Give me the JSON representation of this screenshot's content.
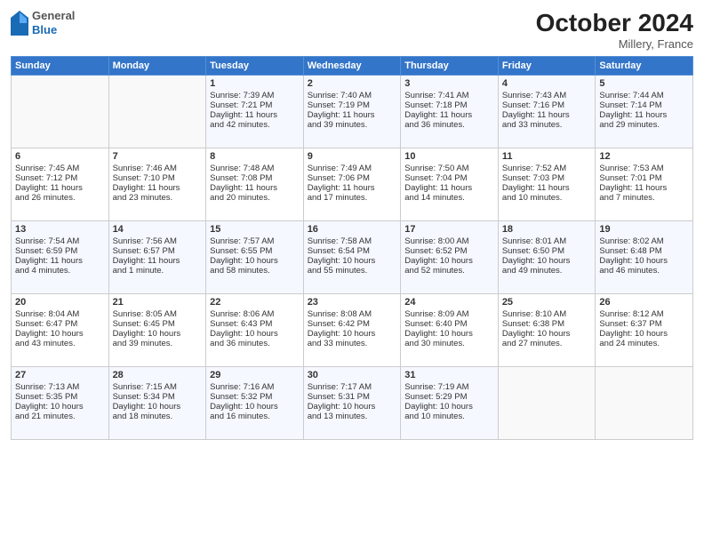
{
  "header": {
    "logo_general": "General",
    "logo_blue": "Blue",
    "month_title": "October 2024",
    "location": "Millery, France"
  },
  "weekdays": [
    "Sunday",
    "Monday",
    "Tuesday",
    "Wednesday",
    "Thursday",
    "Friday",
    "Saturday"
  ],
  "weeks": [
    [
      {
        "day": "",
        "lines": []
      },
      {
        "day": "",
        "lines": []
      },
      {
        "day": "1",
        "lines": [
          "Sunrise: 7:39 AM",
          "Sunset: 7:21 PM",
          "Daylight: 11 hours",
          "and 42 minutes."
        ]
      },
      {
        "day": "2",
        "lines": [
          "Sunrise: 7:40 AM",
          "Sunset: 7:19 PM",
          "Daylight: 11 hours",
          "and 39 minutes."
        ]
      },
      {
        "day": "3",
        "lines": [
          "Sunrise: 7:41 AM",
          "Sunset: 7:18 PM",
          "Daylight: 11 hours",
          "and 36 minutes."
        ]
      },
      {
        "day": "4",
        "lines": [
          "Sunrise: 7:43 AM",
          "Sunset: 7:16 PM",
          "Daylight: 11 hours",
          "and 33 minutes."
        ]
      },
      {
        "day": "5",
        "lines": [
          "Sunrise: 7:44 AM",
          "Sunset: 7:14 PM",
          "Daylight: 11 hours",
          "and 29 minutes."
        ]
      }
    ],
    [
      {
        "day": "6",
        "lines": [
          "Sunrise: 7:45 AM",
          "Sunset: 7:12 PM",
          "Daylight: 11 hours",
          "and 26 minutes."
        ]
      },
      {
        "day": "7",
        "lines": [
          "Sunrise: 7:46 AM",
          "Sunset: 7:10 PM",
          "Daylight: 11 hours",
          "and 23 minutes."
        ]
      },
      {
        "day": "8",
        "lines": [
          "Sunrise: 7:48 AM",
          "Sunset: 7:08 PM",
          "Daylight: 11 hours",
          "and 20 minutes."
        ]
      },
      {
        "day": "9",
        "lines": [
          "Sunrise: 7:49 AM",
          "Sunset: 7:06 PM",
          "Daylight: 11 hours",
          "and 17 minutes."
        ]
      },
      {
        "day": "10",
        "lines": [
          "Sunrise: 7:50 AM",
          "Sunset: 7:04 PM",
          "Daylight: 11 hours",
          "and 14 minutes."
        ]
      },
      {
        "day": "11",
        "lines": [
          "Sunrise: 7:52 AM",
          "Sunset: 7:03 PM",
          "Daylight: 11 hours",
          "and 10 minutes."
        ]
      },
      {
        "day": "12",
        "lines": [
          "Sunrise: 7:53 AM",
          "Sunset: 7:01 PM",
          "Daylight: 11 hours",
          "and 7 minutes."
        ]
      }
    ],
    [
      {
        "day": "13",
        "lines": [
          "Sunrise: 7:54 AM",
          "Sunset: 6:59 PM",
          "Daylight: 11 hours",
          "and 4 minutes."
        ]
      },
      {
        "day": "14",
        "lines": [
          "Sunrise: 7:56 AM",
          "Sunset: 6:57 PM",
          "Daylight: 11 hours",
          "and 1 minute."
        ]
      },
      {
        "day": "15",
        "lines": [
          "Sunrise: 7:57 AM",
          "Sunset: 6:55 PM",
          "Daylight: 10 hours",
          "and 58 minutes."
        ]
      },
      {
        "day": "16",
        "lines": [
          "Sunrise: 7:58 AM",
          "Sunset: 6:54 PM",
          "Daylight: 10 hours",
          "and 55 minutes."
        ]
      },
      {
        "day": "17",
        "lines": [
          "Sunrise: 8:00 AM",
          "Sunset: 6:52 PM",
          "Daylight: 10 hours",
          "and 52 minutes."
        ]
      },
      {
        "day": "18",
        "lines": [
          "Sunrise: 8:01 AM",
          "Sunset: 6:50 PM",
          "Daylight: 10 hours",
          "and 49 minutes."
        ]
      },
      {
        "day": "19",
        "lines": [
          "Sunrise: 8:02 AM",
          "Sunset: 6:48 PM",
          "Daylight: 10 hours",
          "and 46 minutes."
        ]
      }
    ],
    [
      {
        "day": "20",
        "lines": [
          "Sunrise: 8:04 AM",
          "Sunset: 6:47 PM",
          "Daylight: 10 hours",
          "and 43 minutes."
        ]
      },
      {
        "day": "21",
        "lines": [
          "Sunrise: 8:05 AM",
          "Sunset: 6:45 PM",
          "Daylight: 10 hours",
          "and 39 minutes."
        ]
      },
      {
        "day": "22",
        "lines": [
          "Sunrise: 8:06 AM",
          "Sunset: 6:43 PM",
          "Daylight: 10 hours",
          "and 36 minutes."
        ]
      },
      {
        "day": "23",
        "lines": [
          "Sunrise: 8:08 AM",
          "Sunset: 6:42 PM",
          "Daylight: 10 hours",
          "and 33 minutes."
        ]
      },
      {
        "day": "24",
        "lines": [
          "Sunrise: 8:09 AM",
          "Sunset: 6:40 PM",
          "Daylight: 10 hours",
          "and 30 minutes."
        ]
      },
      {
        "day": "25",
        "lines": [
          "Sunrise: 8:10 AM",
          "Sunset: 6:38 PM",
          "Daylight: 10 hours",
          "and 27 minutes."
        ]
      },
      {
        "day": "26",
        "lines": [
          "Sunrise: 8:12 AM",
          "Sunset: 6:37 PM",
          "Daylight: 10 hours",
          "and 24 minutes."
        ]
      }
    ],
    [
      {
        "day": "27",
        "lines": [
          "Sunrise: 7:13 AM",
          "Sunset: 5:35 PM",
          "Daylight: 10 hours",
          "and 21 minutes."
        ]
      },
      {
        "day": "28",
        "lines": [
          "Sunrise: 7:15 AM",
          "Sunset: 5:34 PM",
          "Daylight: 10 hours",
          "and 18 minutes."
        ]
      },
      {
        "day": "29",
        "lines": [
          "Sunrise: 7:16 AM",
          "Sunset: 5:32 PM",
          "Daylight: 10 hours",
          "and 16 minutes."
        ]
      },
      {
        "day": "30",
        "lines": [
          "Sunrise: 7:17 AM",
          "Sunset: 5:31 PM",
          "Daylight: 10 hours",
          "and 13 minutes."
        ]
      },
      {
        "day": "31",
        "lines": [
          "Sunrise: 7:19 AM",
          "Sunset: 5:29 PM",
          "Daylight: 10 hours",
          "and 10 minutes."
        ]
      },
      {
        "day": "",
        "lines": []
      },
      {
        "day": "",
        "lines": []
      }
    ]
  ]
}
